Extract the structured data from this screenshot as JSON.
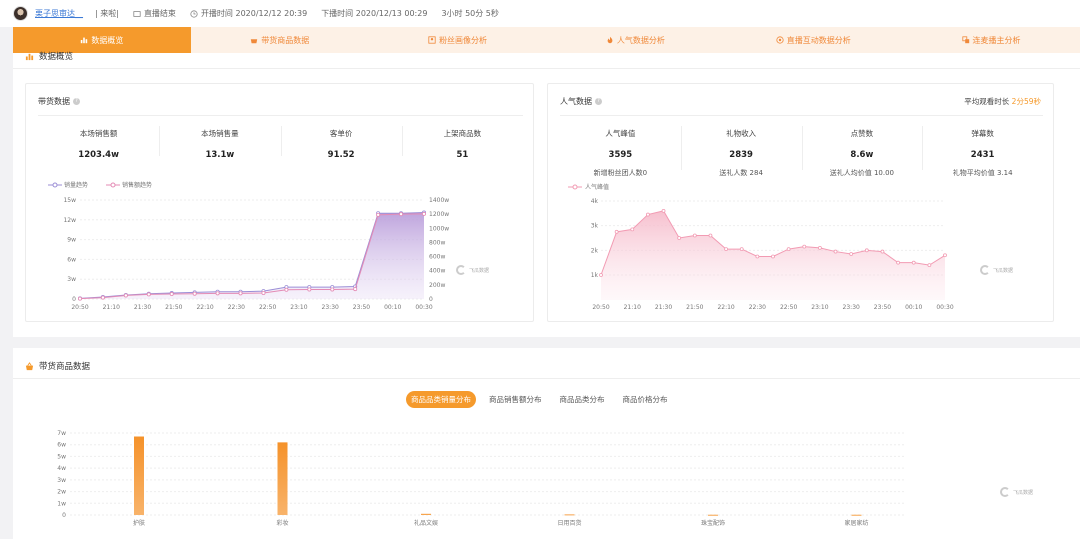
{
  "topbar": {
    "anchor_name": "栗子思审达__",
    "status_tag": "| 来啦|",
    "live_status": "直播结束",
    "start_label": "开播时间 2020/12/12 20:39",
    "end_label": "下播时间 2020/12/13 00:29",
    "duration": "3小时 50分 5秒"
  },
  "tabs": [
    {
      "label": "数据概览",
      "icon": "bar-chart-icon",
      "active": true
    },
    {
      "label": "带货商品数据",
      "icon": "basket-icon",
      "active": false
    },
    {
      "label": "粉丝画像分析",
      "icon": "portrait-icon",
      "active": false
    },
    {
      "label": "人气数据分析",
      "icon": "flame-icon",
      "active": false
    },
    {
      "label": "直播互动数据分析",
      "icon": "chat-icon",
      "active": false
    },
    {
      "label": "连麦播主分析",
      "icon": "link-icon",
      "active": false
    }
  ],
  "overview": {
    "section_title": "数据概览",
    "sales_card": {
      "title": "带货数据",
      "metrics": [
        {
          "label": "本场销售额",
          "value": "1203.4w"
        },
        {
          "label": "本场销售量",
          "value": "13.1w"
        },
        {
          "label": "客单价",
          "value": "91.52"
        },
        {
          "label": "上架商品数",
          "value": "51"
        }
      ]
    },
    "popularity_card": {
      "title": "人气数据",
      "avg_watch_label": "平均观看时长",
      "avg_watch_value": "2分59秒",
      "metrics": [
        {
          "label": "人气峰值",
          "value": "3595",
          "sub": "新增粉丝团人数0"
        },
        {
          "label": "礼物收入",
          "value": "2839",
          "sub": "送礼人数 284"
        },
        {
          "label": "点赞数",
          "value": "8.6w",
          "sub": "送礼人均价值 10.00"
        },
        {
          "label": "弹幕数",
          "value": "2431",
          "sub": "礼物平均价值 3.14"
        }
      ]
    }
  },
  "goods": {
    "section_title": "带货商品数据",
    "pills": [
      {
        "label": "商品品类销量分布",
        "active": true
      },
      {
        "label": "商品销售额分布",
        "active": false
      },
      {
        "label": "商品品类分布",
        "active": false
      },
      {
        "label": "商品价格分布",
        "active": false
      }
    ]
  },
  "watermark": {
    "brand": "飞瓜数据"
  },
  "colors": {
    "accent": "#f59a2c",
    "sales_volume": "#9b8ed6",
    "sales_amount": "#e48bb5",
    "popularity": "#f29bb3"
  },
  "chart_data": [
    {
      "type": "line",
      "legend": [
        "销量趋势",
        "销售额趋势"
      ],
      "x": [
        "20:50",
        "21:10",
        "21:30",
        "21:50",
        "22:10",
        "22:30",
        "22:50",
        "23:10",
        "23:30",
        "23:50",
        "00:10",
        "00:30"
      ],
      "y_left_ticks": [
        "0",
        "3w",
        "6w",
        "9w",
        "12w",
        "15w"
      ],
      "y_right_ticks": [
        "0",
        "200w",
        "400w",
        "600w",
        "800w",
        "1000w",
        "1200w",
        "1400w"
      ],
      "ylim_left": [
        0,
        15
      ],
      "ylim_right": [
        0,
        1400
      ],
      "series": [
        {
          "name": "销量趋势",
          "axis": "left",
          "values": [
            0.1,
            0.3,
            0.6,
            0.8,
            0.9,
            1.0,
            1.1,
            1.1,
            1.2,
            1.8,
            1.8,
            1.8,
            1.9,
            13.0,
            13.0,
            13.1
          ]
        },
        {
          "name": "销售额趋势",
          "axis": "right",
          "values": [
            5,
            20,
            50,
            65,
            70,
            75,
            80,
            80,
            85,
            130,
            135,
            135,
            140,
            1190,
            1200,
            1203
          ]
        }
      ],
      "x_values": [
        "20:42",
        "20:55",
        "21:10",
        "21:25",
        "21:45",
        "22:05",
        "22:25",
        "22:45",
        "23:00",
        "23:10",
        "23:25",
        "23:40",
        "23:55",
        "00:05",
        "00:15",
        "00:25"
      ]
    },
    {
      "type": "area",
      "legend": [
        "人气峰值"
      ],
      "x": [
        "20:50",
        "21:10",
        "21:30",
        "21:50",
        "22:10",
        "22:30",
        "22:50",
        "23:10",
        "23:30",
        "23:50",
        "00:10",
        "00:30"
      ],
      "y_ticks": [
        "1k",
        "2k",
        "3k",
        "4k"
      ],
      "ylim": [
        1000,
        4000
      ],
      "series": [
        {
          "name": "人气峰值",
          "values": [
            1000,
            2750,
            2850,
            3450,
            3600,
            2500,
            2600,
            2600,
            2050,
            2050,
            1750,
            1750,
            2050,
            2150,
            2100,
            1950,
            1850,
            2000,
            1950,
            1500,
            1500,
            1400,
            1800
          ]
        }
      ]
    },
    {
      "type": "bar",
      "categories": [
        "护肤",
        "彩妆",
        "礼品文娱",
        "日用百货",
        "珠宝配饰",
        "家居家纺"
      ],
      "values": [
        6.7,
        6.2,
        0.1,
        0.05,
        0.02,
        0.02
      ],
      "y_ticks": [
        "0",
        "1w",
        "2w",
        "3w",
        "4w",
        "5w",
        "6w",
        "7w"
      ],
      "ylim": [
        0,
        7
      ]
    }
  ]
}
